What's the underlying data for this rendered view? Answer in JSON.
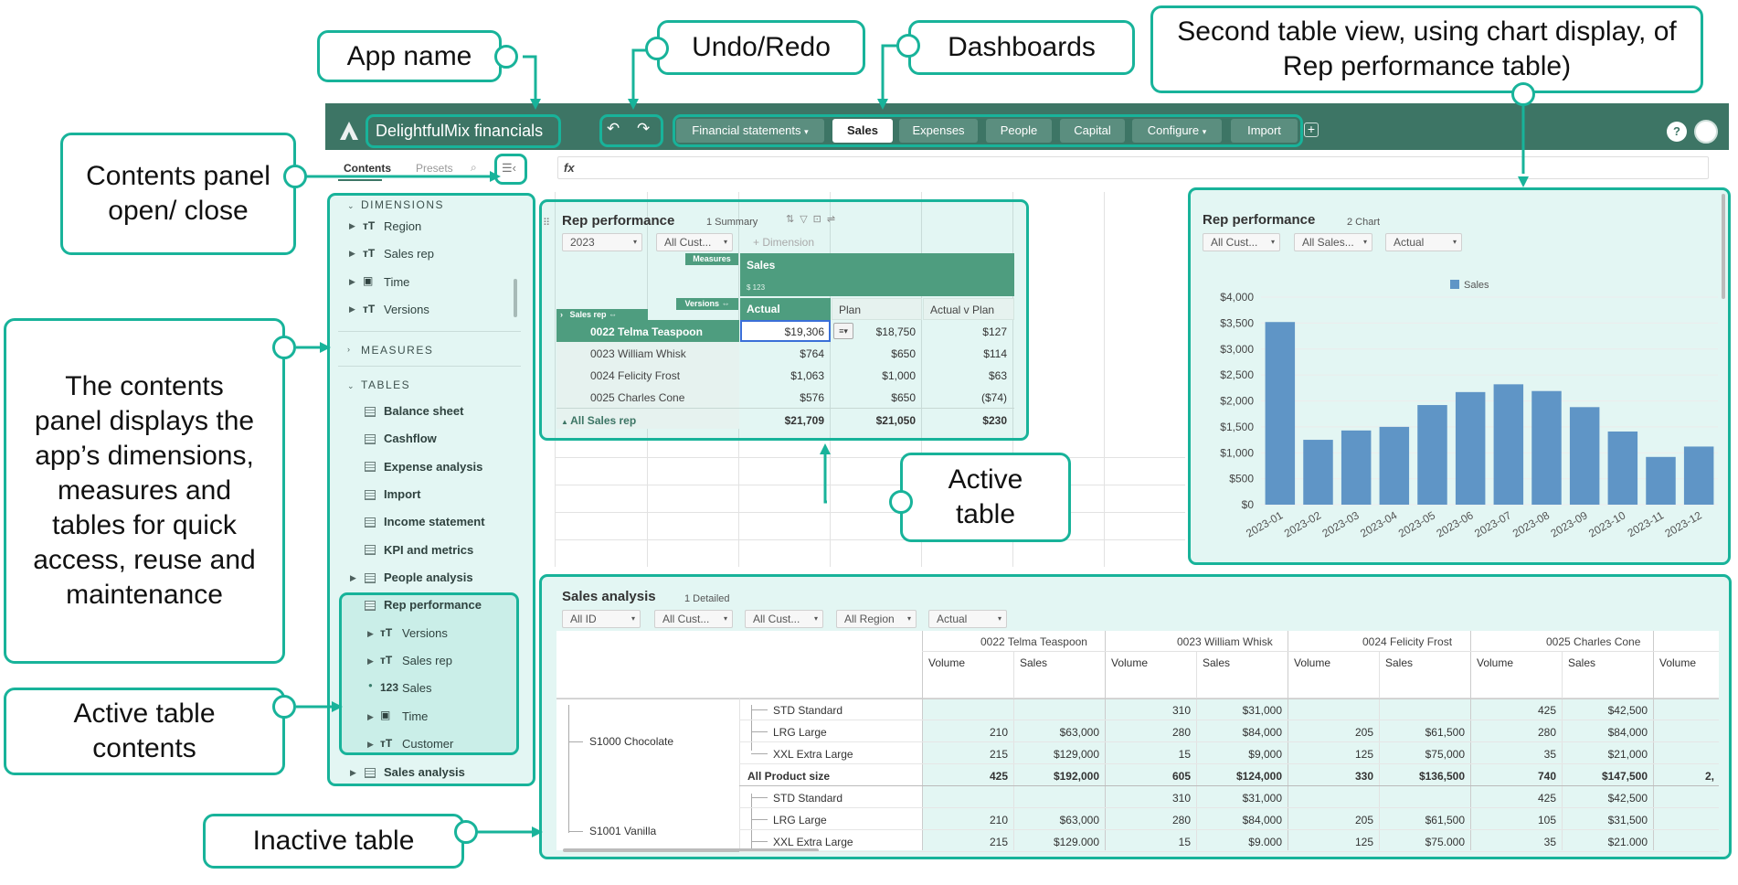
{
  "app": {
    "name": "DelightfulMix financials"
  },
  "tabs": [
    {
      "label": "Financial statements",
      "caret": "▾"
    },
    {
      "label": "Sales"
    },
    {
      "label": "Expenses"
    },
    {
      "label": "People"
    },
    {
      "label": "Capital"
    },
    {
      "label": "Configure",
      "caret": "▾"
    },
    {
      "label": "Import"
    }
  ],
  "sidebar": {
    "tab_contents": "Contents",
    "tab_presets": "Presets",
    "dimensions_title": "DIMENSIONS",
    "dimensions": [
      "Region",
      "Sales rep",
      "Time",
      "Versions"
    ],
    "measures_title": "MEASURES",
    "tables_title": "TABLES",
    "tables": [
      "Balance sheet",
      "Cashflow",
      "Expense analysis",
      "Import",
      "Income statement",
      "KPI and metrics",
      "People analysis",
      "Rep performance"
    ],
    "active_contents": [
      "Versions",
      "Sales rep",
      "Sales",
      "Time",
      "Customer"
    ],
    "last_table": "Sales analysis"
  },
  "formula_bar": {
    "fx": "fx"
  },
  "rep_table": {
    "title": "Rep performance",
    "subtitle": "1 Summary",
    "filters": [
      "2023",
      "All Cust..."
    ],
    "add_dimension": "+ Dimension",
    "measures_label": "Measures",
    "measure_name": "Sales",
    "measure_format": "$  123",
    "versions_label": "Versions",
    "salesrep_label": "Sales rep",
    "columns": [
      "Actual",
      "Plan",
      "Actual v Plan"
    ],
    "rows": [
      {
        "name": "0022 Telma Teaspoon",
        "actual": "$19,306",
        "plan": "$18,750",
        "avp": "$127"
      },
      {
        "name": "0023 William Whisk",
        "actual": "$764",
        "plan": "$650",
        "avp": "$114"
      },
      {
        "name": "0024 Felicity Frost",
        "actual": "$1,063",
        "plan": "$1,000",
        "avp": "$63"
      },
      {
        "name": "0025 Charles Cone",
        "actual": "$576",
        "plan": "$650",
        "avp": "($74)"
      }
    ],
    "total": {
      "name": "All Sales rep",
      "actual": "$21,709",
      "plan": "$21,050",
      "avp": "$230"
    }
  },
  "chart_panel": {
    "title": "Rep performance",
    "subtitle": "2 Chart",
    "filters": [
      "All Cust...",
      "All Sales...",
      "Actual"
    ]
  },
  "chart_data": {
    "type": "bar",
    "categories": [
      "2023-01",
      "2023-02",
      "2023-03",
      "2023-04",
      "2023-05",
      "2023-06",
      "2023-07",
      "2023-08",
      "2023-09",
      "2023-10",
      "2023-11",
      "2023-12"
    ],
    "series": [
      {
        "name": "Sales",
        "values": [
          3520,
          1250,
          1430,
          1500,
          1920,
          2170,
          2320,
          2190,
          1880,
          1410,
          920,
          1120
        ]
      }
    ],
    "ylim": [
      0,
      4000
    ],
    "yticks": [
      "$0",
      "$500",
      "$1,000",
      "$1,500",
      "$2,000",
      "$2,500",
      "$3,000",
      "$3,500",
      "$4,000"
    ],
    "legend": "top-center",
    "color": "#5f95c6"
  },
  "sales_table": {
    "title": "Sales analysis",
    "subtitle": "1 Detailed",
    "filters": [
      "All ID",
      "All Cust...",
      "All Cust...",
      "All Region",
      "Actual"
    ],
    "reps": [
      "0022 Telma Teaspoon",
      "0023 William Whisk",
      "0024 Felicity Frost",
      "0025 Charles Cone"
    ],
    "col_volume": "Volume",
    "col_sales": "Sales",
    "products": [
      "S1000 Chocolate",
      "S1001 Vanilla"
    ],
    "rows": [
      {
        "size": "STD Standard",
        "vals": [
          "",
          "",
          "310",
          "$31,000",
          "",
          "",
          "425",
          "$42,500"
        ]
      },
      {
        "size": "LRG Large",
        "vals": [
          "210",
          "$63,000",
          "280",
          "$84,000",
          "205",
          "$61,500",
          "280",
          "$84,000"
        ]
      },
      {
        "size": "XXL Extra Large",
        "vals": [
          "215",
          "$129,000",
          "15",
          "$9,000",
          "125",
          "$75,000",
          "35",
          "$21,000"
        ]
      },
      {
        "size": "All Product size",
        "vals": [
          "425",
          "$192,000",
          "605",
          "$124,000",
          "330",
          "$136,500",
          "740",
          "$147,500"
        ],
        "bold": true,
        "extra": "2,"
      },
      {
        "size": "STD Standard",
        "vals": [
          "",
          "",
          "310",
          "$31,000",
          "",
          "",
          "425",
          "$42,500"
        ]
      },
      {
        "size": "LRG Large",
        "vals": [
          "210",
          "$63,000",
          "280",
          "$84,000",
          "205",
          "$61,500",
          "105",
          "$31,500"
        ]
      },
      {
        "size": "XXL Extra Large",
        "vals": [
          "215",
          "$129.000",
          "15",
          "$9.000",
          "125",
          "$75.000",
          "35",
          "$21.000"
        ]
      }
    ]
  },
  "callouts": {
    "app_name": "App name",
    "undo_redo": "Undo/Redo",
    "dashboards": "Dashboards",
    "second_view": "Second table view, using chart display, of Rep performance table)",
    "contents_toggle": "Contents panel open/ close",
    "contents_desc": "The contents panel displays the app’s dimensions, measures and tables for quick access, reuse and maintenance",
    "active_contents": "Active table contents",
    "active_table": "Active table",
    "inactive_table": "Inactive table"
  },
  "colors": {
    "accent": "#18b39a",
    "topbar": "#3d7565",
    "table_header": "#4e9d7f",
    "bar": "#5f95c6"
  }
}
